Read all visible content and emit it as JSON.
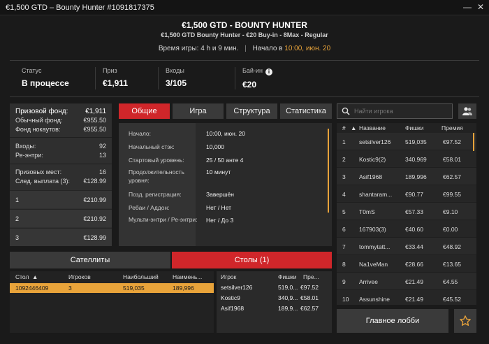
{
  "window": {
    "title": "€1,500 GTD – Bounty Hunter #1091817375",
    "minimize_label": "—",
    "close_label": "✕"
  },
  "header": {
    "title": "€1,500 GTD - BOUNTY HUNTER",
    "subtitle": "€1,500 GTD Bounty Hunter - €20 Buy-in - 8Max - Regular",
    "play_time_label": "Время игры:",
    "play_time_value": "4 h и 9 мин.",
    "start_label": "Начало в",
    "start_value": "10:00, июн. 20"
  },
  "stats": {
    "status_label": "Статус",
    "status_value": "В процессе",
    "prize_label": "Приз",
    "prize_value": "€1,911",
    "entries_label": "Входы",
    "entries_value": "3/105",
    "buyin_label": "Бай-ин",
    "buyin_value": "€20"
  },
  "prize_panel": {
    "prize_pool_label": "Призовой фонд:",
    "prize_pool_value": "€1,911",
    "regular_pool_label": "Обычный фонд:",
    "regular_pool_value": "€955.50",
    "knockout_pool_label": "Фонд нокаутов:",
    "knockout_pool_value": "€955.50",
    "entries_label": "Входы:",
    "entries_value": "92",
    "reentries_label": "Ре-энтри:",
    "reentries_value": "13",
    "places_label": "Призовых мест:",
    "places_value": "16",
    "next_payout_label": "След. выплата (3):",
    "next_payout_value": "€128.99",
    "payouts": [
      {
        "place": "1",
        "amount": "€210.99"
      },
      {
        "place": "2",
        "amount": "€210.92"
      },
      {
        "place": "3",
        "amount": "€128.99"
      }
    ]
  },
  "tabs": [
    "Общие",
    "Игра",
    "Структура",
    "Статистика"
  ],
  "details": [
    {
      "label": "Начало:",
      "value": "10:00, июн. 20"
    },
    {
      "label": "Начальный стэк:",
      "value": "10,000"
    },
    {
      "label": "Стартовый уровень:",
      "value": "25 / 50 анте 4"
    },
    {
      "label": "Продолжительность уровня:",
      "value": "10 минут"
    },
    {
      "label": "Позд. регистрация:",
      "value": "Завершён"
    },
    {
      "label": "Ребаи / Аддон:",
      "value": "Нет / Нет"
    },
    {
      "label": "Мульти-энтри / Ре-энтри:",
      "value": "Нет / До 3"
    }
  ],
  "search": {
    "placeholder": "Найти игрока"
  },
  "players": {
    "headers": {
      "rank": "#",
      "sort_arrow": "▲",
      "name": "Название",
      "chips": "Фишки",
      "prize": "Премия"
    },
    "rows": [
      {
        "rank": "1",
        "name": "setsilver126",
        "chips": "519,035",
        "prize": "€97.52"
      },
      {
        "rank": "2",
        "name": "Kostic9(2)",
        "chips": "340,969",
        "prize": "€58.01"
      },
      {
        "rank": "3",
        "name": "Asif1968",
        "chips": "189,996",
        "prize": "€62.57"
      },
      {
        "rank": "4",
        "name": "shantaram...",
        "chips": "€90.77",
        "prize": "€99.55"
      },
      {
        "rank": "5",
        "name": "T0mS",
        "chips": "€57.33",
        "prize": "€9.10"
      },
      {
        "rank": "6",
        "name": "167903(3)",
        "chips": "€40.60",
        "prize": "€0.00"
      },
      {
        "rank": "7",
        "name": "tommytatt...",
        "chips": "€33.44",
        "prize": "€48.92"
      },
      {
        "rank": "8",
        "name": "Na1veMan",
        "chips": "€28.66",
        "prize": "€13.65"
      },
      {
        "rank": "9",
        "name": "Arrivee",
        "chips": "€21.49",
        "prize": "€4.55"
      },
      {
        "rank": "10",
        "name": "Assunshine",
        "chips": "€21.49",
        "prize": "€45.52"
      }
    ]
  },
  "lobby_button": "Главное лобби",
  "bottom_tabs": {
    "satellites": "Сателлиты",
    "tables": "Столы (1)"
  },
  "tables": {
    "headers": {
      "table": "Стол",
      "sort_arrow": "▲",
      "players": "Игроков",
      "largest": "Наибольший",
      "smallest": "Наимень..."
    },
    "rows": [
      {
        "table": "1092446409",
        "players": "3",
        "largest": "519,035",
        "smallest": "189,996"
      }
    ]
  },
  "table_players": {
    "headers": {
      "player": "Игрок",
      "chips": "Фишки",
      "prize": "Пре..."
    },
    "rows": [
      {
        "player": "setsilver126",
        "chips": "519,0...",
        "prize": "€97.52"
      },
      {
        "player": "Kostic9",
        "chips": "340,9...",
        "prize": "€58.01"
      },
      {
        "player": "Asif1968",
        "chips": "189,9...",
        "prize": "€62.57"
      }
    ]
  },
  "colors": {
    "accent_red": "#d0262a",
    "accent_orange": "#e8a33a",
    "background": "#1a1a1a"
  },
  "icons": [
    "info-icon",
    "search-icon",
    "players-icon",
    "star-icon",
    "close-icon",
    "minimize-icon",
    "sort-asc-icon"
  ]
}
